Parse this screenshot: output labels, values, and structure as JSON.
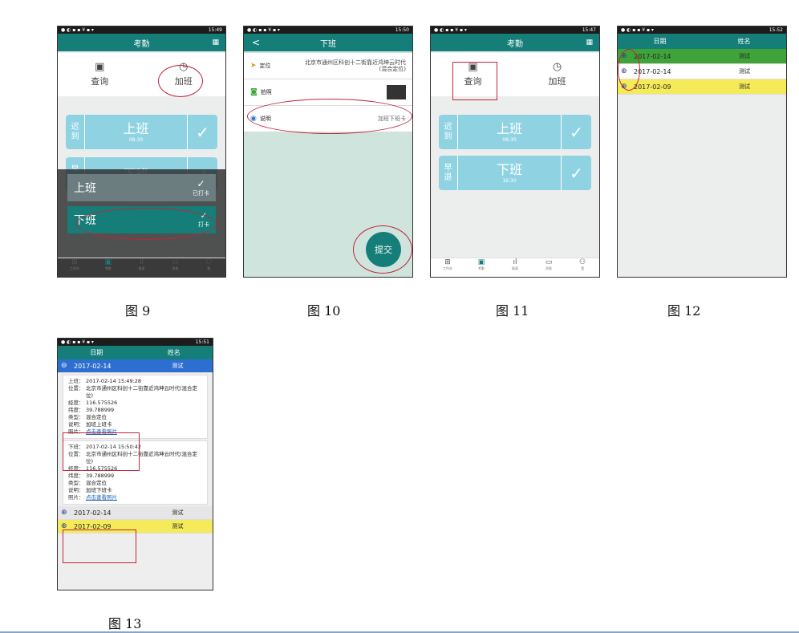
{
  "status": {
    "icons": "● ◐ ▪ ▪ ¥ ▪ ▾",
    "right": "⊙ ▾ ◿",
    "battery": "100%▮"
  },
  "captions": [
    "图 9",
    "图 10",
    "图 11",
    "图 12",
    "图 13"
  ],
  "p9": {
    "time": "15:49",
    "title": "考勤",
    "tab1": "查询",
    "tab2": "加班",
    "card1_side": "迟到",
    "card1_title": "上班",
    "card1_time": "08:30",
    "card2_side": "早退",
    "card2_title": "下班",
    "popup_on": "上班",
    "popup_on_status": "已打卡",
    "popup_off": "下班",
    "popup_off_status": "打卡",
    "nav": [
      "工作台",
      "考勤",
      "报表",
      "消息",
      "我"
    ]
  },
  "p10": {
    "time": "15:50",
    "title": "下班",
    "back": "<",
    "loc_label": "定位",
    "loc_value": "北京市通州区科创十二街靠近鸿坤云时代(混合定位)",
    "photo_label": "拍照",
    "note_label": "说明",
    "note_value": "加班下班卡",
    "submit": "提交"
  },
  "p11": {
    "time": "15:47",
    "title": "考勤",
    "tab1": "查询",
    "tab2": "加班",
    "card1_side": "迟到",
    "card1_title": "上班",
    "card1_time": "08:30",
    "card2_side": "早退",
    "card2_title": "下班",
    "card2_time": "16:30",
    "nav": [
      "工作台",
      "考勤",
      "报表",
      "消息",
      "我"
    ]
  },
  "p12": {
    "time": "15:52",
    "col1": "日期",
    "col2": "姓名",
    "rows": [
      {
        "date": "2017-02-14",
        "name": "测试"
      },
      {
        "date": "2017-02-14",
        "name": "测试"
      },
      {
        "date": "2017-02-09",
        "name": "测试"
      }
    ]
  },
  "p13": {
    "time": "15:51",
    "col1": "日期",
    "col2": "姓名",
    "open_date": "2017-02-14",
    "open_name": "测试",
    "on": {
      "k": "上班：",
      "v": "2017-02-14 15:49:28",
      "pos_k": "位置：",
      "pos_v": "北京市通州区科创十二街靠近鸿坤云时代(混合定位)",
      "lon_k": "经度：",
      "lon_v": "116.575526",
      "lat_k": "纬度：",
      "lat_v": "39.788999",
      "type_k": "类型：",
      "type_v": "混合定位",
      "note_k": "说明：",
      "note_v": "加班上班卡",
      "pic_k": "照片：",
      "pic_v": "点击查看照片"
    },
    "off": {
      "k": "下班：",
      "v": "2017-02-14 15:50:42",
      "pos_k": "位置：",
      "pos_v": "北京市通州区科创十二街靠近鸿坤云时代(混合定位)",
      "lon_k": "经度：",
      "lon_v": "116.575526",
      "lat_k": "纬度：",
      "lat_v": "39.788999",
      "type_k": "类型：",
      "type_v": "混合定位",
      "note_k": "说明：",
      "note_v": "加班下班卡",
      "pic_k": "照片：",
      "pic_v": "点击查看照片"
    },
    "rows": [
      {
        "date": "2017-02-14",
        "name": "测试"
      },
      {
        "date": "2017-02-09",
        "name": "测试"
      }
    ]
  },
  "colors": {
    "teal": "#157e79",
    "light_blue": "#8fd3e3",
    "green": "#3fa33a",
    "yellow": "#f5ea5a",
    "blue": "#2d6fd0",
    "annotation": "#c0253d"
  }
}
